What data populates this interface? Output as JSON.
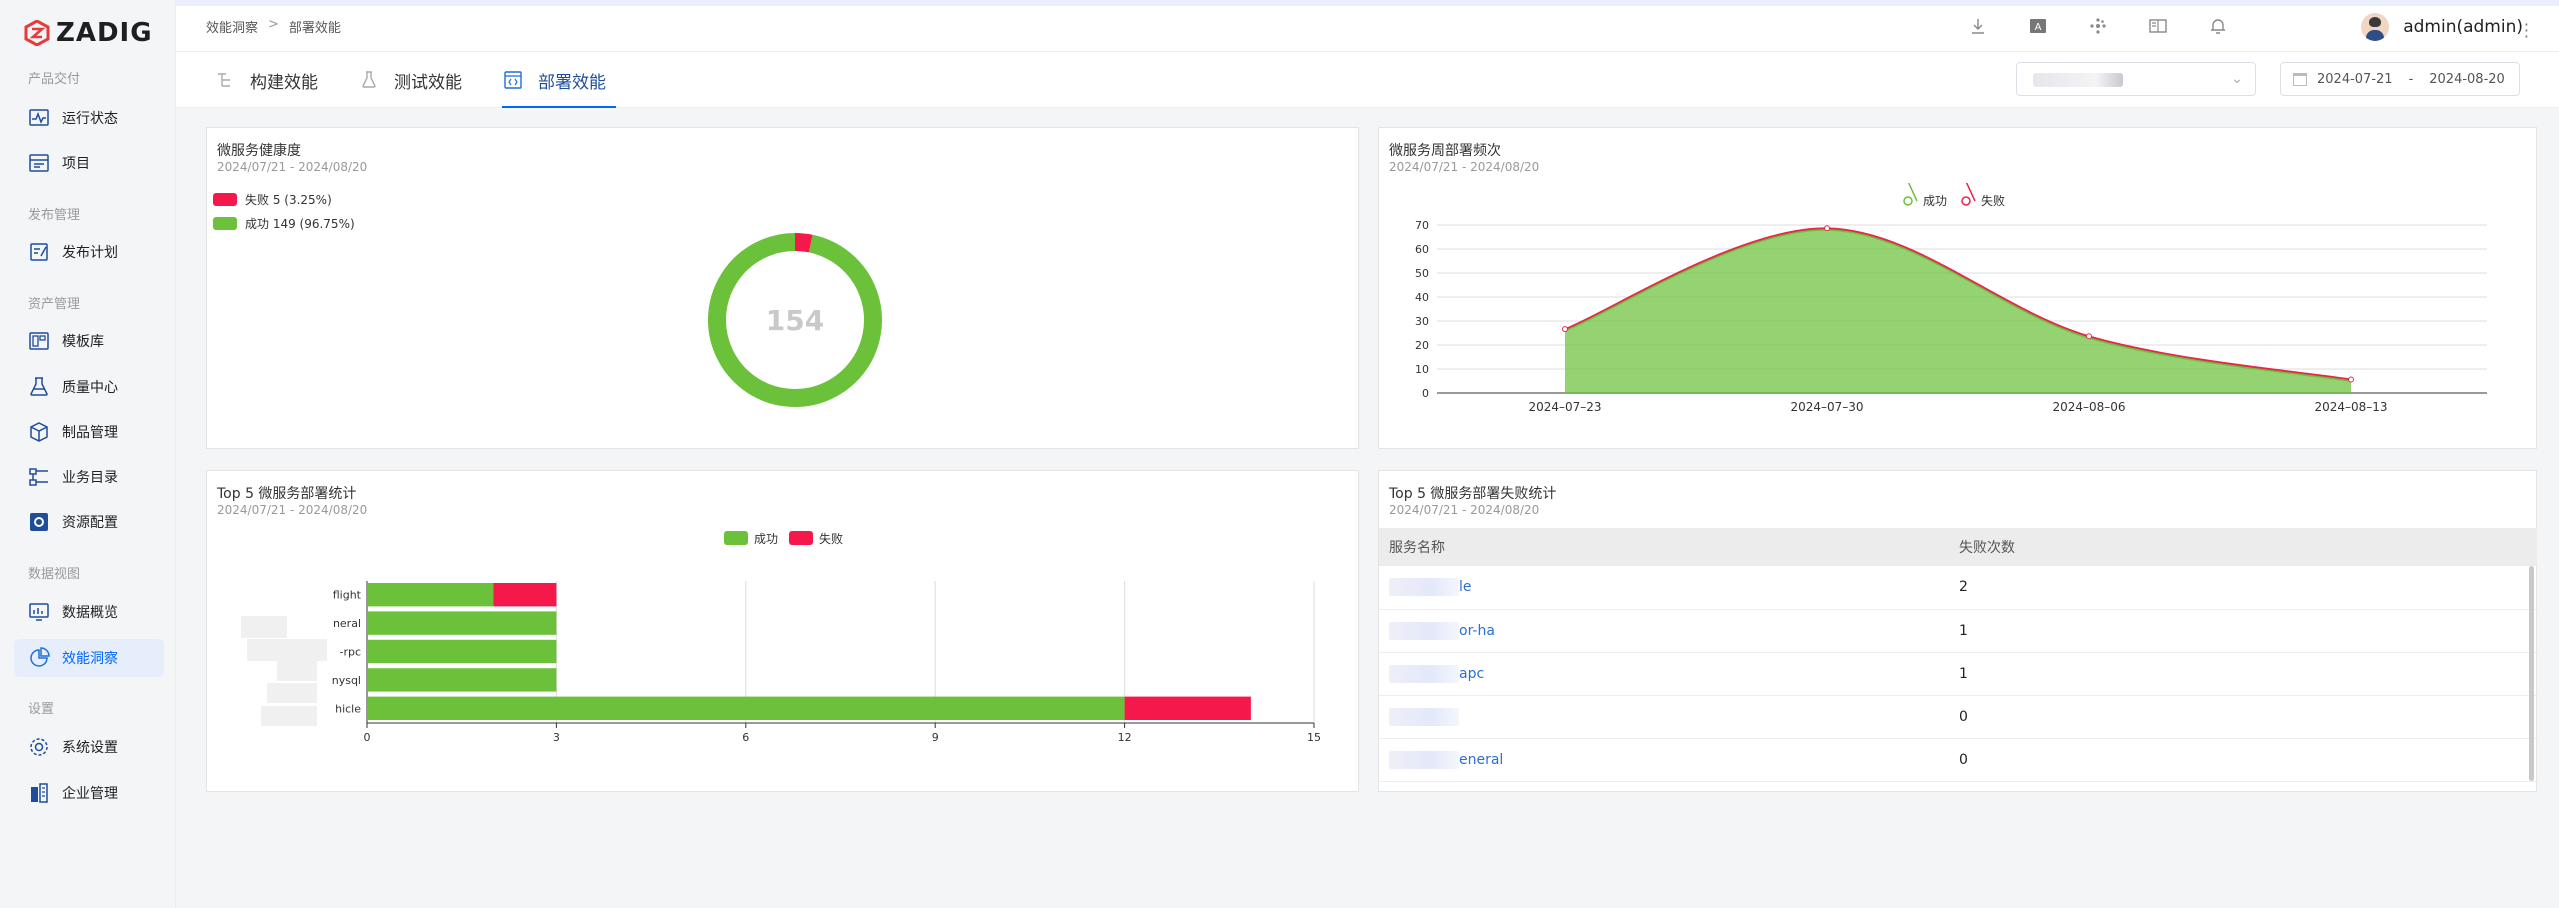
{
  "brand": {
    "logo_text": "ZADIG",
    "accent": "#0066ff"
  },
  "sidebar": {
    "sections": [
      {
        "label": "产品交付",
        "items": [
          {
            "label": "运行状态",
            "icon": "pulse-icon"
          },
          {
            "label": "项目",
            "icon": "project-icon"
          }
        ]
      },
      {
        "label": "发布管理",
        "items": [
          {
            "label": "发布计划",
            "icon": "release-plan-icon"
          }
        ]
      },
      {
        "label": "资产管理",
        "items": [
          {
            "label": "模板库",
            "icon": "template-icon"
          },
          {
            "label": "质量中心",
            "icon": "flask-icon"
          },
          {
            "label": "制品管理",
            "icon": "package-icon"
          },
          {
            "label": "业务目录",
            "icon": "catalog-icon"
          },
          {
            "label": "资源配置",
            "icon": "resource-gear-icon"
          }
        ]
      },
      {
        "label": "数据视图",
        "items": [
          {
            "label": "数据概览",
            "icon": "monitor-chart-icon"
          },
          {
            "label": "效能洞察",
            "icon": "pie-insight-icon",
            "active": true
          }
        ]
      },
      {
        "label": "设置",
        "items": [
          {
            "label": "系统设置",
            "icon": "gear-icon"
          },
          {
            "label": "企业管理",
            "icon": "building-icon"
          }
        ]
      }
    ]
  },
  "header": {
    "breadcrumb": [
      "效能洞察",
      ">",
      "部署效能"
    ],
    "icons": [
      "download-icon",
      "translate-icon",
      "plugin-icon",
      "book-icon",
      "bell-icon"
    ],
    "user": "admin(admin)"
  },
  "tabs": [
    {
      "label": "构建效能",
      "icon": "build-icon"
    },
    {
      "label": "测试效能",
      "icon": "test-flask-icon"
    },
    {
      "label": "部署效能",
      "icon": "code-deploy-icon",
      "active": true
    }
  ],
  "filters": {
    "date_start": "2024-07-21",
    "date_sep": "-",
    "date_end": "2024-08-20"
  },
  "health": {
    "title": "微服务健康度",
    "subtitle": "2024/07/21 - 2024/08/20",
    "legend": [
      {
        "label": "失败 5 (3.25%)",
        "color": "#f5184a"
      },
      {
        "label": "成功 149 (96.75%)",
        "color": "#6cc13b"
      }
    ],
    "total": "154"
  },
  "weekly": {
    "title": "微服务周部署频次",
    "subtitle": "2024/07/21 - 2024/08/20",
    "legend": [
      {
        "label": "成功",
        "color": "#6cc13b"
      },
      {
        "label": "失败",
        "color": "#e8264d"
      }
    ]
  },
  "top5": {
    "title": "Top 5 微服务部署统计",
    "subtitle": "2024/07/21 - 2024/08/20",
    "legend": [
      {
        "label": "成功",
        "color": "#6cc13b"
      },
      {
        "label": "失败",
        "color": "#f5184a"
      }
    ]
  },
  "top5fail": {
    "title": "Top 5 微服务部署失败统计",
    "subtitle": "2024/07/21 - 2024/08/20",
    "headers": [
      "服务名称",
      "失败次数"
    ],
    "rows": [
      {
        "name": "le",
        "count": "2"
      },
      {
        "name": "or-ha",
        "count": "1"
      },
      {
        "name": "apc",
        "count": "1"
      },
      {
        "name": "",
        "count": "0"
      },
      {
        "name": "eneral",
        "count": "0"
      }
    ]
  },
  "chart_data": [
    {
      "type": "pie",
      "title": "微服务健康度",
      "categories": [
        "失败",
        "成功"
      ],
      "values": [
        5,
        149
      ],
      "colors": [
        "#f5184a",
        "#6cc13b"
      ],
      "center_label": "154"
    },
    {
      "type": "area",
      "title": "微服务周部署频次",
      "x": [
        "2024-07-23",
        "2024-07-30",
        "2024-08-06",
        "2024-08-13"
      ],
      "series": [
        {
          "name": "成功",
          "values": [
            26,
            68,
            23,
            5
          ],
          "color": "#6cc13b"
        },
        {
          "name": "失败",
          "values": [
            26,
            68,
            23,
            5
          ],
          "color": "#e8264d"
        }
      ],
      "yticks": [
        0,
        10,
        20,
        30,
        40,
        50,
        60,
        70
      ],
      "ylim": [
        0,
        70
      ],
      "legend": "top-center"
    },
    {
      "type": "bar",
      "orientation": "horizontal",
      "title": "Top 5 微服务部署统计",
      "categories": [
        "flight",
        "neral",
        "-rpc",
        "nysql",
        "hicle"
      ],
      "series": [
        {
          "name": "成功",
          "values": [
            2,
            3,
            3,
            3,
            12
          ],
          "color": "#6cc13b"
        },
        {
          "name": "失败",
          "values": [
            1,
            0,
            0,
            0,
            2
          ],
          "color": "#f5184a"
        }
      ],
      "xticks": [
        0,
        3,
        6,
        9,
        12,
        15
      ],
      "xlim": [
        0,
        15
      ],
      "legend": "top-center"
    }
  ]
}
